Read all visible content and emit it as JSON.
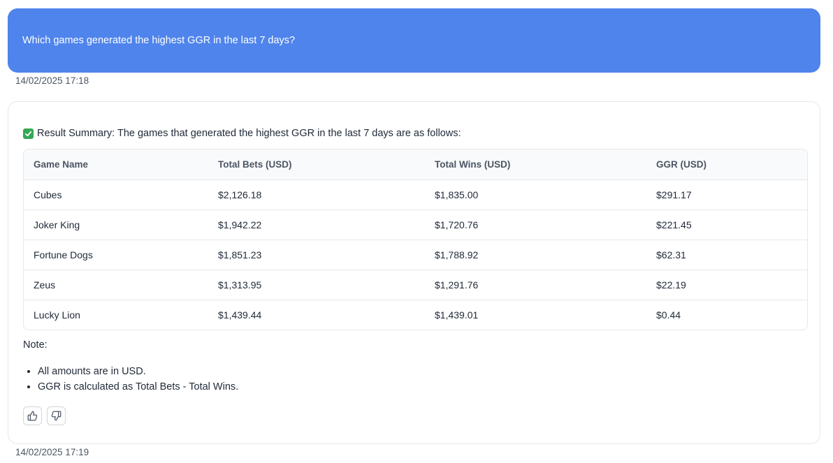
{
  "user_message": {
    "text": "Which games generated the highest GGR in the last 7 days?",
    "timestamp": "14/02/2025 17:18"
  },
  "assistant_message": {
    "summary": "Result Summary: The games that generated the highest GGR in the last 7 days are as follows:",
    "summary_icon": "check-icon",
    "table": {
      "headers": [
        "Game Name",
        "Total Bets (USD)",
        "Total Wins (USD)",
        "GGR (USD)"
      ],
      "rows": [
        [
          "Cubes",
          "$2,126.18",
          "$1,835.00",
          "$291.17"
        ],
        [
          "Joker King",
          "$1,942.22",
          "$1,720.76",
          "$221.45"
        ],
        [
          "Fortune Dogs",
          "$1,851.23",
          "$1,788.92",
          "$62.31"
        ],
        [
          "Zeus",
          "$1,313.95",
          "$1,291.76",
          "$22.19"
        ],
        [
          "Lucky Lion",
          "$1,439.44",
          "$1,439.01",
          "$0.44"
        ]
      ]
    },
    "note_label": "Note:",
    "notes": [
      "All amounts are in USD.",
      "GGR is calculated as Total Bets - Total Wins."
    ],
    "feedback": {
      "like_icon": "thumbs-up-icon",
      "dislike_icon": "thumbs-down-icon"
    },
    "timestamp": "14/02/2025 17:19"
  },
  "colors": {
    "user_bubble": "#4f84ec",
    "check": "#34a853"
  }
}
